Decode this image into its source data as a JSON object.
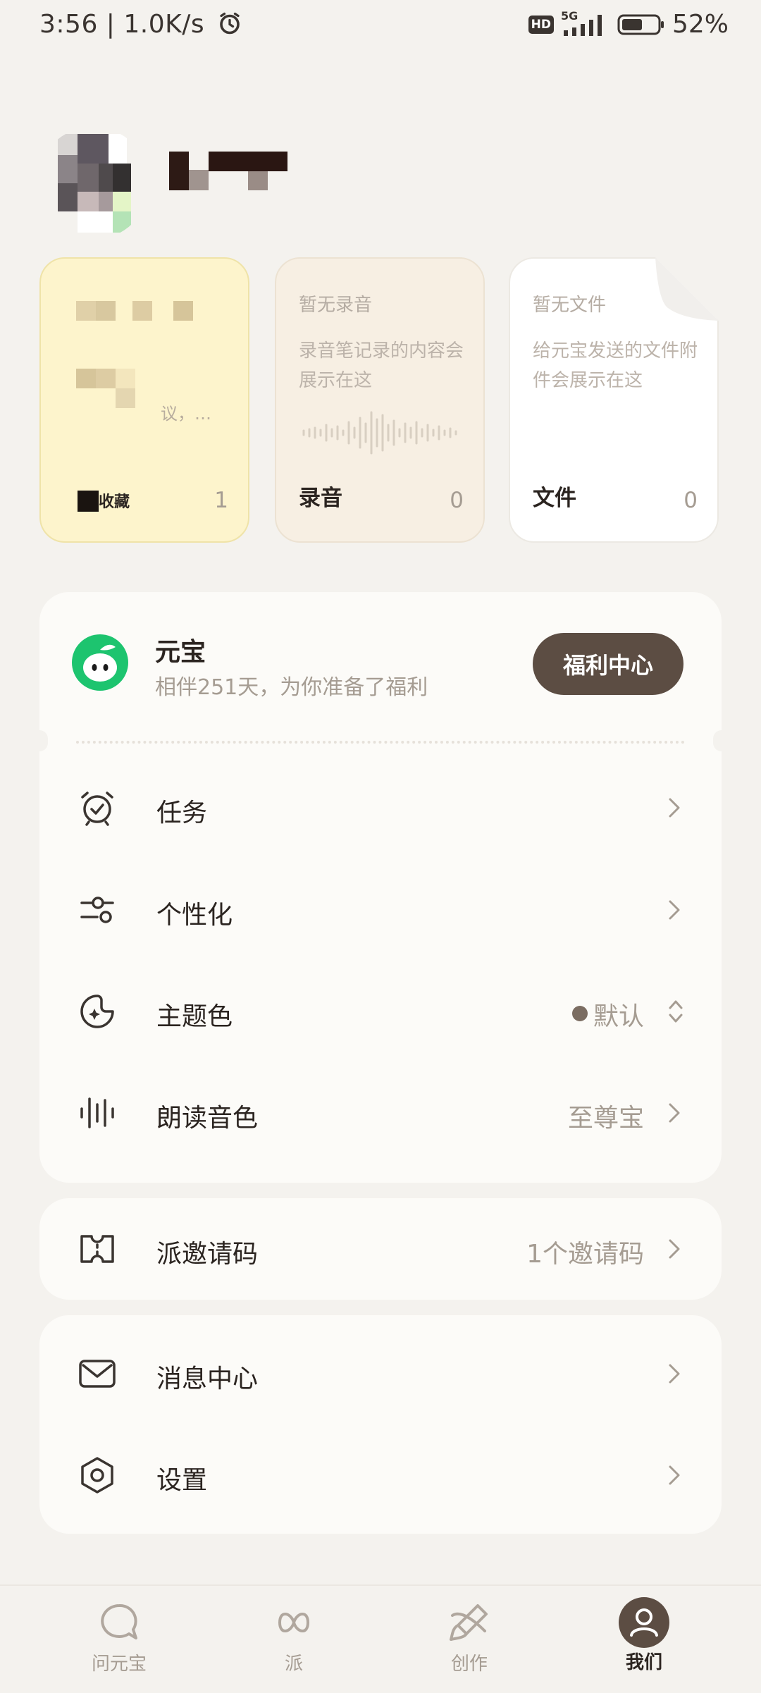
{
  "status_bar": {
    "time": "3:56",
    "network_speed": "1.0K/s",
    "hd": "HD",
    "signal": "5G",
    "battery": "52%"
  },
  "cards": [
    {
      "name": "收藏",
      "count": "1",
      "hint": "",
      "desc": "议，…"
    },
    {
      "name": "录音",
      "count": "0",
      "hint": "暂无录音",
      "desc": "录音笔记录的内容会展示在这"
    },
    {
      "name": "文件",
      "count": "0",
      "hint": "暂无文件",
      "desc": "给元宝发送的文件附件会展示在这"
    }
  ],
  "yuanbao": {
    "title": "元宝",
    "subtitle": "相伴251天，为你准备了福利",
    "button": "福利中心"
  },
  "menu": [
    {
      "label": "任务",
      "icon": "alarm-clock-icon"
    },
    {
      "label": "个性化",
      "icon": "sliders-icon"
    },
    {
      "label": "主题色",
      "value": "默认",
      "icon": "palette-icon"
    },
    {
      "label": "朗读音色",
      "value": "至尊宝",
      "icon": "waveform-icon"
    }
  ],
  "invite": {
    "label": "派邀请码",
    "value": "1个邀请码",
    "icon": "ticket-icon"
  },
  "menu2": [
    {
      "label": "消息中心",
      "icon": "mail-icon"
    },
    {
      "label": "设置",
      "icon": "settings-hexagon-icon"
    }
  ],
  "nav": [
    {
      "label": "问元宝",
      "icon": "chat-bubble-icon"
    },
    {
      "label": "派",
      "icon": "infinity-icon"
    },
    {
      "label": "创作",
      "icon": "brush-icon"
    },
    {
      "label": "我们",
      "icon": "user-avatar-icon",
      "active": true
    }
  ],
  "colors": {
    "background": "#f4f2ee",
    "accent": "#5c4d43",
    "brand_green": "#1dc46f",
    "notes_card": "#fdf4cc"
  }
}
